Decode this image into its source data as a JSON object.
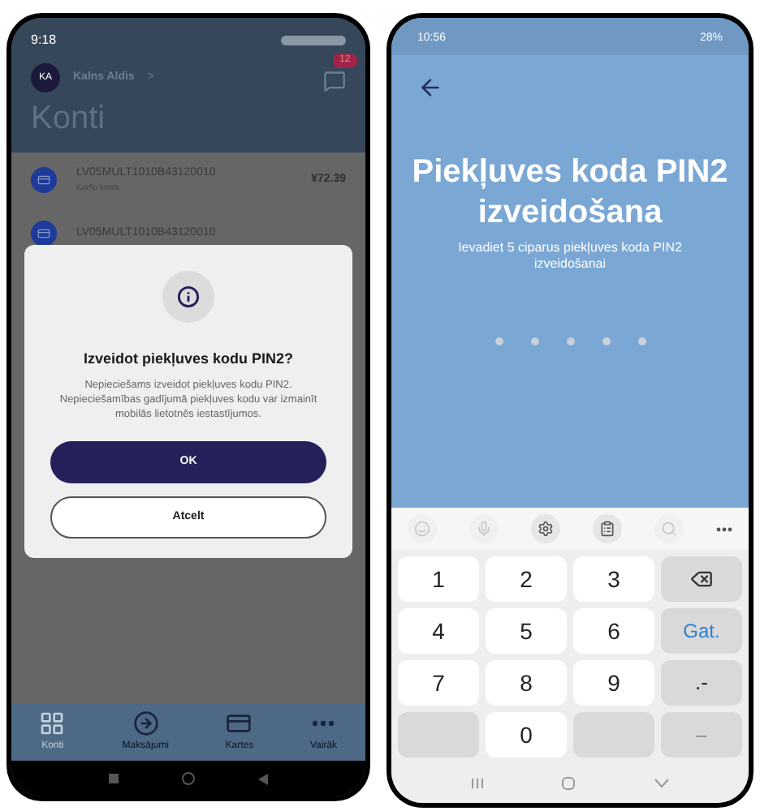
{
  "left_phone": {
    "status_bar": {
      "time": "9:18"
    },
    "header": {
      "initials": "KA",
      "name": "Kalns Aldis",
      "chevron": ">",
      "badge": "12",
      "title": "Konti"
    },
    "accounts": [
      {
        "iban": "LV05MULT1010B43120010",
        "subtitle": "Karšu konts",
        "amount": "¥72.39"
      },
      {
        "iban": "LV05MULT1010B43120010"
      }
    ],
    "dialog": {
      "title": "Izveidot piekļuves kodu PIN2?",
      "body": "Nepieciešams izveidot piekļuves kodu PIN2. Nepieciešamības gadījumā piekļuves kodu var izmainīt mobilās lietotnēs iestastījumos.",
      "buttons": [
        {
          "label": "OK",
          "kind": "primary"
        },
        {
          "label": "Atcelt",
          "kind": "secondary"
        }
      ]
    },
    "bottom_nav": [
      {
        "label": "Konti",
        "kind": "grid",
        "selected": true
      },
      {
        "label": "Maksājumi",
        "kind": "payment",
        "selected": false
      },
      {
        "label": "Kartes",
        "kind": "card",
        "selected": false
      },
      {
        "label": "Vairāk",
        "kind": "more",
        "selected": false
      }
    ]
  },
  "right_phone": {
    "status_bar": {
      "time": "10:56",
      "battery": "28%"
    },
    "title": "Piekļuves koda PIN2 izveidošana",
    "subtitle": "Ievadiet 5 ciparus piekļuves koda PIN2 izveidošanai",
    "pin_dots": [
      {
        "filled": false
      },
      {
        "filled": false
      },
      {
        "filled": false
      },
      {
        "filled": false
      },
      {
        "filled": false
      }
    ],
    "keyboard_toolbar": [
      {
        "kind": "emoji",
        "disabled": true
      },
      {
        "kind": "mic",
        "disabled": true
      },
      {
        "kind": "settings",
        "disabled": false
      },
      {
        "kind": "clipboard",
        "disabled": false
      },
      {
        "kind": "search",
        "disabled": true
      },
      {
        "kind": "more",
        "disabled": false
      }
    ],
    "keys": [
      {
        "kind": "digit",
        "label": "1"
      },
      {
        "kind": "digit",
        "label": "2"
      },
      {
        "kind": "digit",
        "label": "3"
      },
      {
        "kind": "backspace"
      },
      {
        "kind": "digit",
        "label": "4"
      },
      {
        "kind": "digit",
        "label": "5"
      },
      {
        "kind": "digit",
        "label": "6"
      },
      {
        "kind": "action",
        "label": "Gat."
      },
      {
        "kind": "digit",
        "label": "7"
      },
      {
        "kind": "digit",
        "label": "8"
      },
      {
        "kind": "digit",
        "label": "9"
      },
      {
        "kind": "symbol",
        "label": ".-"
      },
      {
        "kind": "blank"
      },
      {
        "kind": "digit",
        "label": "0"
      },
      {
        "kind": "blank"
      },
      {
        "kind": "symbol_disabled",
        "label": "–"
      }
    ]
  }
}
